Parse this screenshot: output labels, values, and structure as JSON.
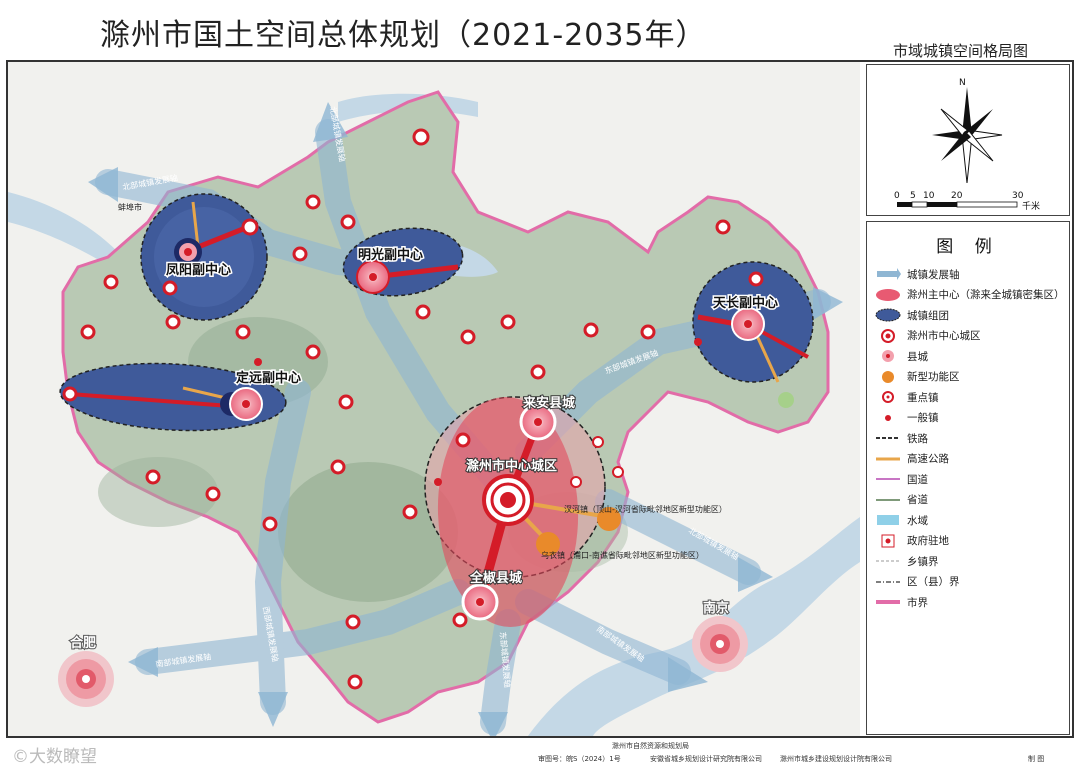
{
  "title": "滁州市国土空间总体规划（2021-2035年）",
  "subtitle": "市域城镇空间格局图",
  "colors": {
    "development_axis": "#8fb6d3",
    "main_center": "#e85a72",
    "cluster": "#2f4a8a",
    "center_red": "#d41c28",
    "new_zone": "#e98a2a"
  },
  "compass": {
    "north": "N",
    "scale_ticks": [
      "0",
      "5",
      "10",
      "20",
      "30"
    ],
    "scale_unit": "千米"
  },
  "legend": {
    "title": "图 例",
    "items": [
      {
        "label": "城镇发展轴",
        "icon": "axis-arrow"
      },
      {
        "label": "滁州主中心（滁来全城镇密集区）",
        "icon": "main-center"
      },
      {
        "label": "城镇组团",
        "icon": "cluster"
      },
      {
        "label": "滁州市中心城区",
        "icon": "city-center"
      },
      {
        "label": "县城",
        "icon": "county"
      },
      {
        "label": "新型功能区",
        "icon": "new-zone"
      },
      {
        "label": "重点镇",
        "icon": "key-town"
      },
      {
        "label": "一般镇",
        "icon": "town"
      },
      {
        "label": "铁路",
        "icon": "railway"
      },
      {
        "label": "高速公路",
        "icon": "expressway"
      },
      {
        "label": "国道",
        "icon": "national-road"
      },
      {
        "label": "省道",
        "icon": "provincial-road"
      },
      {
        "label": "水域",
        "icon": "water"
      },
      {
        "label": "政府驻地",
        "icon": "government"
      },
      {
        "label": "乡镇界",
        "icon": "township-boundary"
      },
      {
        "label": "区（县）界",
        "icon": "district-boundary"
      },
      {
        "label": "市界",
        "icon": "city-boundary"
      }
    ]
  },
  "map_labels": {
    "fengyang": "凤阳副中心",
    "mingguang": "明光副中心",
    "dingyuan": "定远副中心",
    "tianchang": "天长副中心",
    "laian": "来安县城",
    "chuzhou": "滁州市中心城区",
    "quanjiao": "全椒县城",
    "hefei": "合肥",
    "nanjing": "南京",
    "zone1": "汊河镇（顶山-汊河省际毗邻地区新型功能区）",
    "zone2": "乌衣镇（浦口-南谯省际毗邻地区新型功能区）",
    "axis_north": "北部城镇发展轴",
    "axis_east": "东部城镇发展轴",
    "axis_south": "南部城镇发展轴",
    "axis_west": "西部城镇发展轴",
    "axis_ne": "北部城镇发展轴",
    "axis_se": "南部城镇发展轴",
    "axis_n": "北部城镇发展轴",
    "axis_s": "东部城镇发展轴",
    "bengbu": "蚌埠市"
  },
  "footer": {
    "watermark": "©大数瞭望",
    "approval": "审图号：皖S（2024）1号",
    "org1": "安徽省城乡规划设计研究院有限公司",
    "org2": "滁州市城乡建设规划设计院有限公司",
    "org3": "滁州市自然资源和规划局",
    "org4": "制 图"
  }
}
